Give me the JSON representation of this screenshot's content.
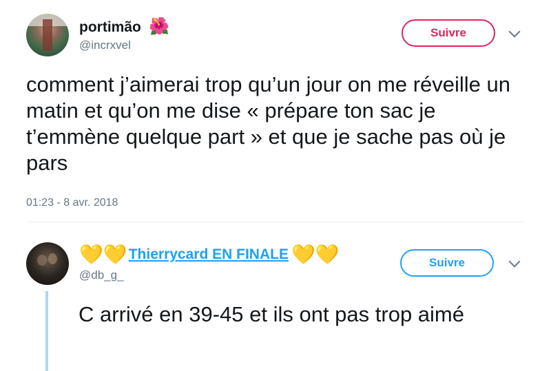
{
  "tweet": {
    "author_name": "portimão",
    "author_emoji": "🌺",
    "author_handle": "@incrxvel",
    "follow_label": "Suivre",
    "text": "comment j’aimerai trop qu’un jour on me réveille un matin et qu’on me dise « prépare ton sac je t’emmène quelque part » et que je sache pas où je pars",
    "timestamp": "01:23 - 8 avr. 2018"
  },
  "reply": {
    "author_prefix_hearts": "💛💛",
    "author_name": "Thierrycard EN FINALE",
    "author_suffix_hearts": "💛💛",
    "author_handle": "@db_g_",
    "follow_label": "Suivre",
    "text": "C arrivé en 39-45 et ils ont pas trop aimé"
  },
  "colors": {
    "follow_primary": "#e0245e",
    "follow_reply": "#1da1f2",
    "thread_line": "#a8d8f8",
    "secondary_text": "#657786"
  }
}
